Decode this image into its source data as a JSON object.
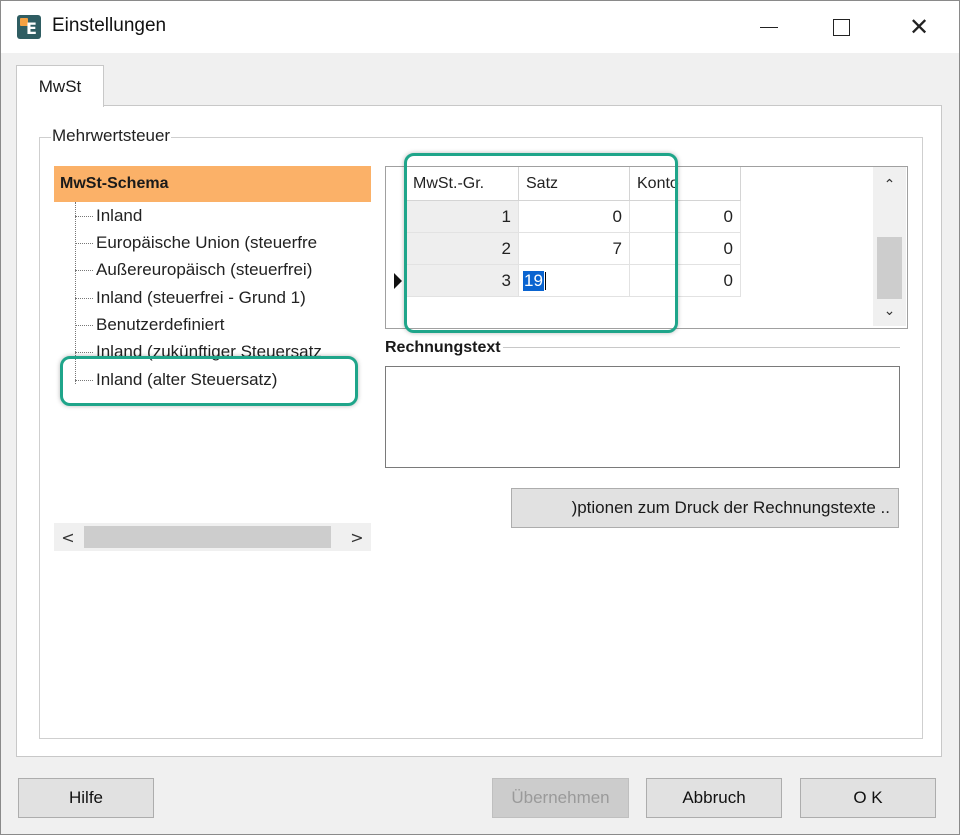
{
  "window": {
    "title": "Einstellungen",
    "controls": {
      "minimize": "",
      "maximize": "",
      "close": "✕"
    }
  },
  "tabs": [
    {
      "label": "MwSt"
    }
  ],
  "group": {
    "label": "Mehrwertsteuer"
  },
  "tree": {
    "header": "MwSt-Schema",
    "items": [
      {
        "label": "Inland"
      },
      {
        "label": "Europäische Union (steuerfre"
      },
      {
        "label": "Außereuropäisch (steuerfrei)"
      },
      {
        "label": "Inland (steuerfrei - Grund 1)"
      },
      {
        "label": "Benutzerdefiniert"
      },
      {
        "label": "Inland (zukünftiger Steuersatz"
      },
      {
        "label": "Inland (alter Steuersatz)"
      }
    ],
    "scroll": {
      "left": "<",
      "right": ">"
    }
  },
  "grid": {
    "columns": [
      "MwSt.-Gr.",
      "Satz",
      "Konto"
    ],
    "rows": [
      {
        "gruppe": "1",
        "satz": "0",
        "konto": "0"
      },
      {
        "gruppe": "2",
        "satz": "7",
        "konto": "0"
      },
      {
        "gruppe": "3",
        "satz": "19",
        "konto": "0"
      }
    ],
    "scroll": {
      "up": "⌃",
      "down": "⌄"
    }
  },
  "rechnungstext": {
    "label": "Rechnungstext",
    "value": ""
  },
  "print_options_button": ")ptionen zum Druck der Rechnungstexte ..",
  "buttons": {
    "hilfe": "Hilfe",
    "uebernehmen": "Übernehmen",
    "abbruch": "Abbruch",
    "ok": "O K"
  },
  "colors": {
    "tree_header": "#fbb168",
    "highlight": "#1fa58a",
    "selection": "#0a64d0"
  }
}
